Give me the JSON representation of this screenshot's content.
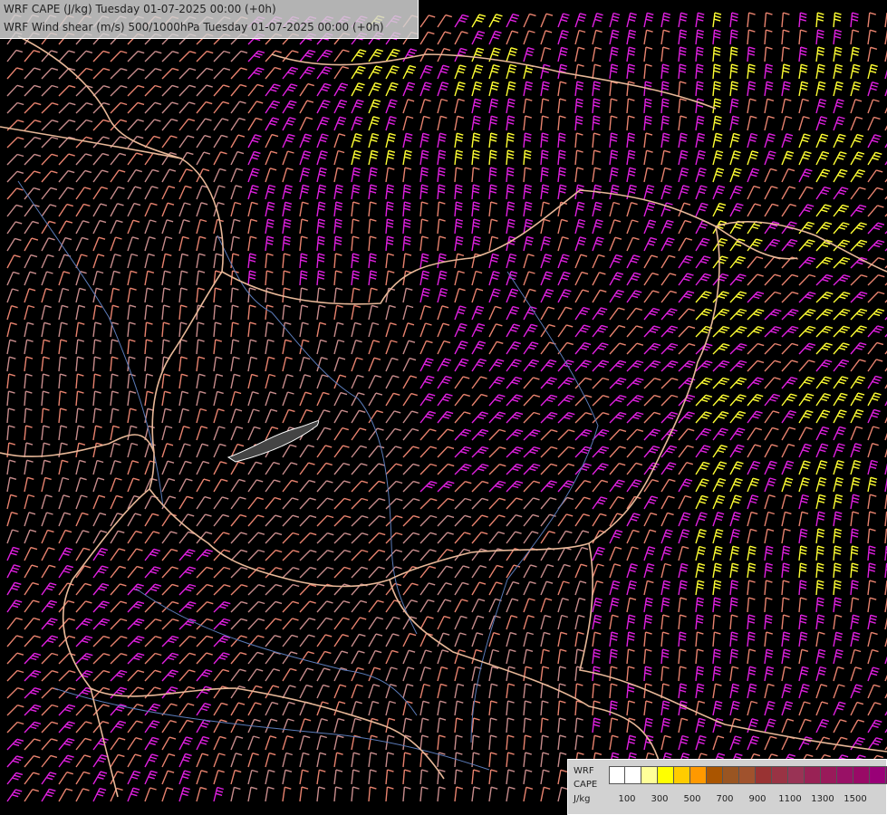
{
  "titles": {
    "line1": "WRF CAPE (J/kg) Tuesday 01-07-2025 00:00 (+0h)",
    "line2": "WRF Wind shear (m/s) 500/1000hPa Tuesday 01-07-2025 00:00 (+0h)"
  },
  "legend": {
    "label_line1": "WRF",
    "label_line2": "CAPE",
    "label_line3": "J/kg",
    "swatch_colors": [
      "#ffffff",
      "#ffffff",
      "#ffff99",
      "#ffff00",
      "#ffcc00",
      "#ff9900",
      "#aa5500",
      "#995522",
      "#a0522d",
      "#993333",
      "#993344",
      "#993355",
      "#992255",
      "#991a5a",
      "#991166",
      "#990a66",
      "#990077",
      "#880066",
      "#770055"
    ],
    "ticks": [
      "100",
      "300",
      "500",
      "700",
      "900",
      "1100",
      "1300",
      "1500"
    ]
  },
  "wind_colors": {
    "light": "#c88c8c",
    "salmon": "#e8826e",
    "magenta": "#e020e0",
    "yellow": "#ffff33"
  },
  "border_color": "#e8b898",
  "river_color": "#5a7ab8"
}
